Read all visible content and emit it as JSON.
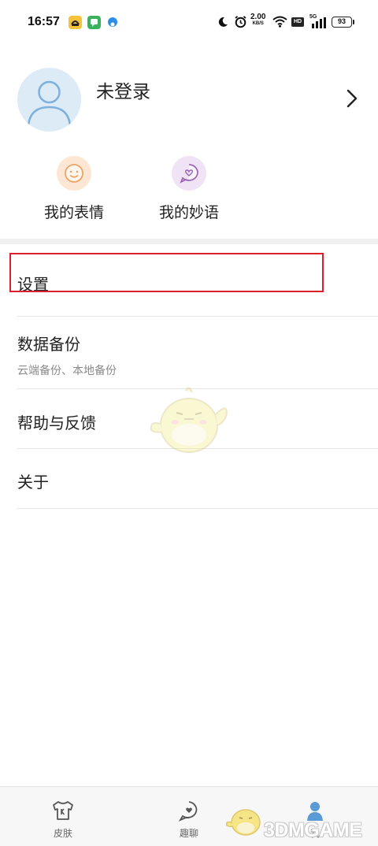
{
  "status_bar": {
    "time": "16:57",
    "net_speed_value": "2.00",
    "net_speed_unit": "KB/S",
    "hd_label": "HD",
    "network_label": "5G",
    "battery": "93",
    "icons": [
      "app-notification-icon",
      "message-icon",
      "app-badge-icon",
      "moon-icon",
      "alarm-icon",
      "wifi-icon",
      "signal-icon"
    ]
  },
  "profile": {
    "username": "未登录",
    "avatar_icon": "user-avatar-icon",
    "arrow_icon": "chevron-right-icon"
  },
  "quick_actions": [
    {
      "label": "我的表情",
      "icon": "smile-face-icon",
      "color": "#fbe7d4"
    },
    {
      "label": "我的妙语",
      "icon": "heart-bubble-icon",
      "color": "#efe3f5"
    }
  ],
  "menu": {
    "settings": {
      "title": "设置"
    },
    "backup": {
      "title": "数据备份",
      "subtitle": "云端备份、本地备份"
    },
    "help": {
      "title": "帮助与反馈"
    },
    "about": {
      "title": "关于"
    }
  },
  "bottom_nav": [
    {
      "label": "皮肤",
      "icon": "skin-shirt-icon"
    },
    {
      "label": "趣聊",
      "icon": "chat-heart-icon"
    },
    {
      "label": "我",
      "icon": "me-person-icon",
      "active": true
    }
  ],
  "watermark": "3DMGAME",
  "colors": {
    "highlight": "#d9202f",
    "active_nav": "#5b9bd5",
    "avatar_bg": "#ddebf7"
  }
}
